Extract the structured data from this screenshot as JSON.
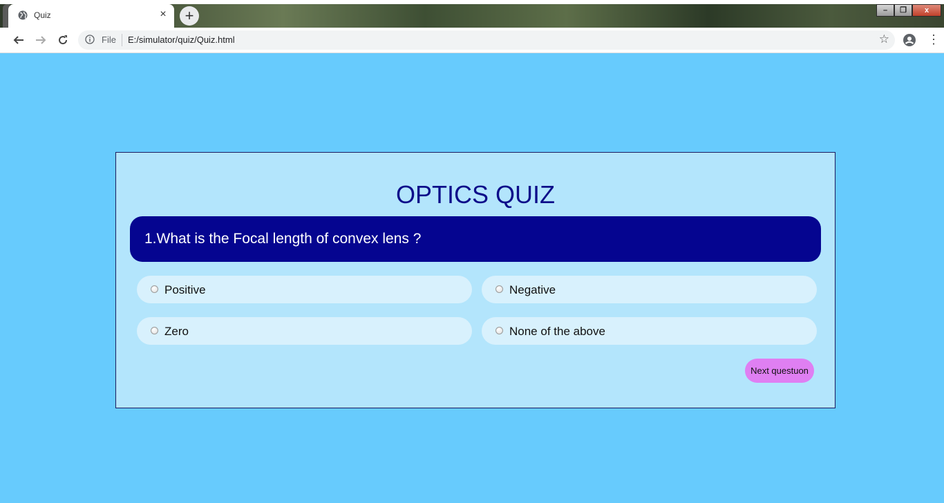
{
  "browser": {
    "tab_title": "Quiz",
    "tab_close_glyph": "×",
    "new_tab_glyph": "+",
    "window_controls": {
      "minimize": "–",
      "restore": "❐",
      "close": "x"
    },
    "nav": {
      "back_icon": "arrow-left-icon",
      "forward_icon": "arrow-right-icon",
      "reload_icon": "reload-icon"
    },
    "address": {
      "scheme_label": "File",
      "url": "E:/simulator/quiz/Quiz.html"
    }
  },
  "quiz": {
    "title": "OPTICS QUIZ",
    "question": "1.What is the Focal length of convex lens ?",
    "options": [
      {
        "label": "Positive"
      },
      {
        "label": "Negative"
      },
      {
        "label": "Zero"
      },
      {
        "label": "None of the above"
      }
    ],
    "next_button_label": "Next questuon"
  },
  "colors": {
    "page_background": "#67cbfd",
    "card_background": "#b3e5fc",
    "title_color": "#0d0d8a",
    "question_background": "#050590",
    "option_background": "#d8f1fd",
    "next_button_background": "#df7ff2"
  }
}
